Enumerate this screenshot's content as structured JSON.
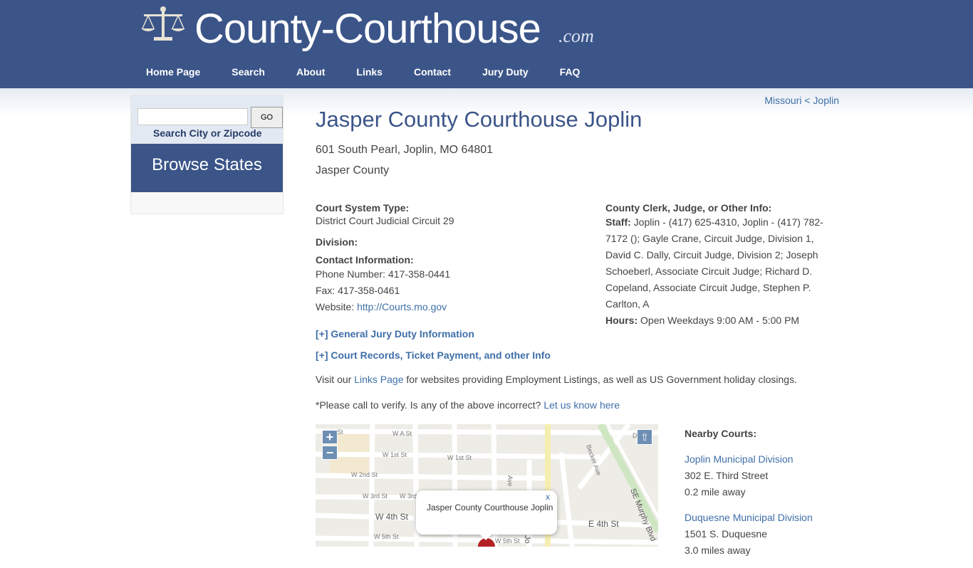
{
  "header": {
    "site_name": "County-Courthouse",
    "site_tld": ".com",
    "nav": [
      "Home Page",
      "Search",
      "About",
      "Links",
      "Contact",
      "Jury Duty",
      "FAQ"
    ]
  },
  "sidebar": {
    "search_button": "GO",
    "search_label": "Search City or Zipcode",
    "browse_states": "Browse States"
  },
  "breadcrumb": {
    "state": "Missouri",
    "separator": " < ",
    "city": "Joplin"
  },
  "courthouse": {
    "title": "Jasper County Courthouse Joplin",
    "address": "601 South Pearl, Joplin, MO 64801",
    "county": "Jasper County"
  },
  "details": {
    "court_system_label": "Court System Type:",
    "court_system_value": "District Court Judicial Circuit 29",
    "division_label": "Division:",
    "contact_label": "Contact Information:",
    "phone": "Phone Number: 417-358-0441",
    "fax": "Fax: 417-358-0461",
    "website_label": "Website: ",
    "website_url": "http://Courts.mo.gov",
    "other_label": "County Clerk, Judge, or Other Info:",
    "staff_label": "Staff:",
    "staff_value": " Joplin - (417) 625-4310, Joplin - (417) 782-7172 (); Gayle Crane, Circuit Judge, Division 1, David C. Dally, Circuit Judge, Division 2; Joseph Schoeberl, Associate Circuit Judge; Richard D. Copeland, Associate Circuit Judge, Stephen P. Carlton, A",
    "hours_label": "Hours:",
    "hours_value": " Open Weekdays 9:00 AM - 5:00 PM"
  },
  "links": {
    "jury": "[+] General Jury Duty Information",
    "records": "[+] Court Records, Ticket Payment, and other Info",
    "visit_prefix": "Visit our ",
    "visit_link": "Links Page",
    "visit_suffix": " for websites providing Employment Listings, as well as US Government holiday closings.",
    "verify_prefix": "*Please call to verify. Is any of the above incorrect? ",
    "verify_link": "Let us know here"
  },
  "map": {
    "zoom_in": "+",
    "zoom_out": "−",
    "popup_text": "Jasper County Courthouse Joplin",
    "popup_close": "x",
    "streets": [
      "W A St",
      "W 1st St",
      "W 1st St",
      "W 2nd St",
      "W 3rd St",
      "W 3rd",
      "W 4th St",
      "E 4th St",
      "W 5th St",
      "W 5th St",
      "Becker Ave",
      "SE Murphy Blvd",
      "Ave",
      "Jo",
      "th St",
      "Da"
    ]
  },
  "nearby": {
    "title": "Nearby Courts:",
    "items": [
      {
        "name": "Joplin Municipal Division",
        "address": "302 E. Third Street",
        "distance": "0.2 mile away"
      },
      {
        "name": "Duquesne Municipal Division",
        "address": "1501 S. Duquesne",
        "distance": "3.0 miles away"
      }
    ]
  },
  "colors": {
    "header_bg": "#3b5589",
    "link": "#3f6fa8",
    "title": "#3b5589"
  }
}
